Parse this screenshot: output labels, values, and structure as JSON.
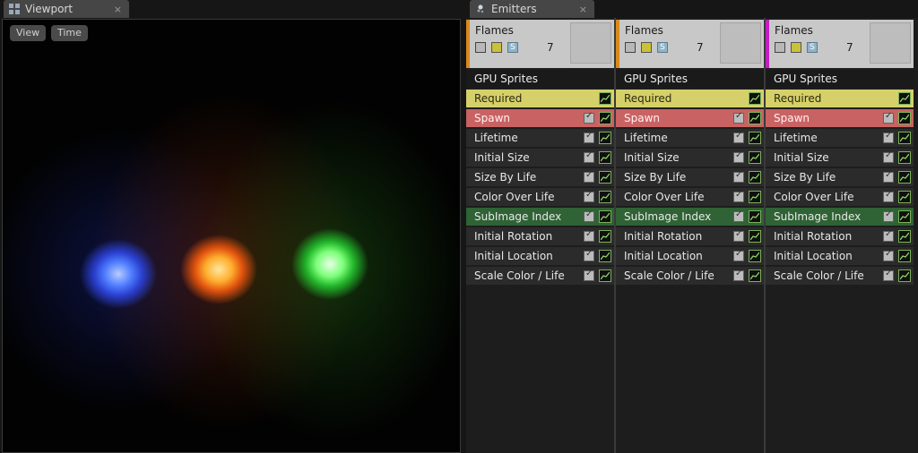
{
  "viewport": {
    "tab_label": "Viewport",
    "close": "×",
    "buttons": [
      "View",
      "Time"
    ]
  },
  "emitters_panel": {
    "tab_label": "Emitters",
    "close": "×",
    "columns": [
      {
        "name": "Flames",
        "count": "7",
        "accent_color": "#d98a1c",
        "type": "GPU Sprites",
        "modules": [
          {
            "label": "Required",
            "kind": "required"
          },
          {
            "label": "Spawn",
            "kind": "spawn"
          },
          {
            "label": "Lifetime",
            "kind": "normal"
          },
          {
            "label": "Initial Size",
            "kind": "normal"
          },
          {
            "label": "Size By Life",
            "kind": "normal"
          },
          {
            "label": "Color Over Life",
            "kind": "normal"
          },
          {
            "label": "SubImage Index",
            "kind": "subimage"
          },
          {
            "label": "Initial Rotation",
            "kind": "normal"
          },
          {
            "label": "Initial Location",
            "kind": "normal"
          },
          {
            "label": "Scale Color / Life",
            "kind": "normal"
          }
        ]
      },
      {
        "name": "Flames",
        "count": "7",
        "accent_color": "#d98a1c",
        "type": "GPU Sprites",
        "modules": [
          {
            "label": "Required",
            "kind": "required"
          },
          {
            "label": "Spawn",
            "kind": "spawn"
          },
          {
            "label": "Lifetime",
            "kind": "normal"
          },
          {
            "label": "Initial Size",
            "kind": "normal"
          },
          {
            "label": "Size By Life",
            "kind": "normal"
          },
          {
            "label": "Color Over Life",
            "kind": "normal"
          },
          {
            "label": "SubImage Index",
            "kind": "subimage"
          },
          {
            "label": "Initial Rotation",
            "kind": "normal"
          },
          {
            "label": "Initial Location",
            "kind": "normal"
          },
          {
            "label": "Scale Color / Life",
            "kind": "normal"
          }
        ]
      },
      {
        "name": "Flames",
        "count": "7",
        "accent_color": "#c21fc2",
        "type": "GPU Sprites",
        "modules": [
          {
            "label": "Required",
            "kind": "required"
          },
          {
            "label": "Spawn",
            "kind": "spawn"
          },
          {
            "label": "Lifetime",
            "kind": "normal"
          },
          {
            "label": "Initial Size",
            "kind": "normal"
          },
          {
            "label": "Size By Life",
            "kind": "normal"
          },
          {
            "label": "Color Over Life",
            "kind": "normal"
          },
          {
            "label": "SubImage Index",
            "kind": "subimage"
          },
          {
            "label": "Initial Rotation",
            "kind": "normal"
          },
          {
            "label": "Initial Location",
            "kind": "normal"
          },
          {
            "label": "Scale Color / Life",
            "kind": "normal"
          }
        ]
      }
    ]
  },
  "icons": {
    "emitter_enable": "checkbox-icon",
    "emitter_mode": "grid-icon",
    "emitter_solo": "solo-icon",
    "module_enable": "checkbox-icon",
    "module_curve": "curve-editor-icon"
  },
  "colors": {
    "required_row": "#d6d06a",
    "spawn_row": "#c96262",
    "subimage_row": "#2f6234",
    "flame_blue": "#3a6bff",
    "flame_orange": "#ff8a1a",
    "flame_green": "#5cff6a"
  }
}
